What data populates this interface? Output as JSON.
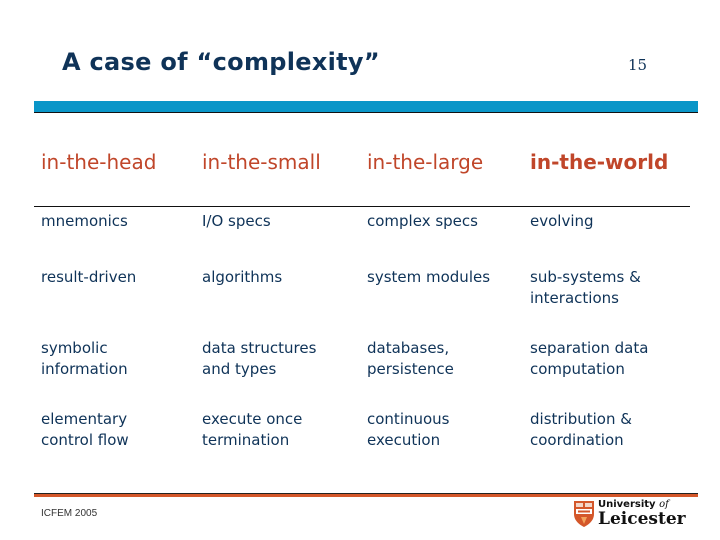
{
  "slide": {
    "title": "A case of “complexity”",
    "page_number": "15",
    "accent_colors": {
      "top_bar": "#0a96c8",
      "bottom_bar": "#d4572a",
      "header_text": "#c0462a",
      "body_text": "#0f3358"
    }
  },
  "table": {
    "headers": [
      "in-the-head",
      "in-the-small",
      "in-the-large",
      "in-the-world"
    ],
    "rows": [
      [
        "mnemonics",
        "I/O specs",
        "complex specs",
        "evolving"
      ],
      [
        "result-driven",
        "algorithms",
        "system modules",
        "sub-systems &\ninteractions"
      ],
      [
        "symbolic\ninformation",
        "data structures\nand types",
        "databases,\npersistence",
        "separation data\ncomputation"
      ],
      [
        "elementary\ncontrol flow",
        "execute once\ntermination",
        "continuous\nexecution",
        "distribution &\ncoordination"
      ]
    ]
  },
  "footer": {
    "text": "ICFEM 2005",
    "logo": {
      "line1": "University",
      "line1_suffix": "of",
      "line2": "Leicester",
      "icon": "university-shield-icon"
    }
  }
}
